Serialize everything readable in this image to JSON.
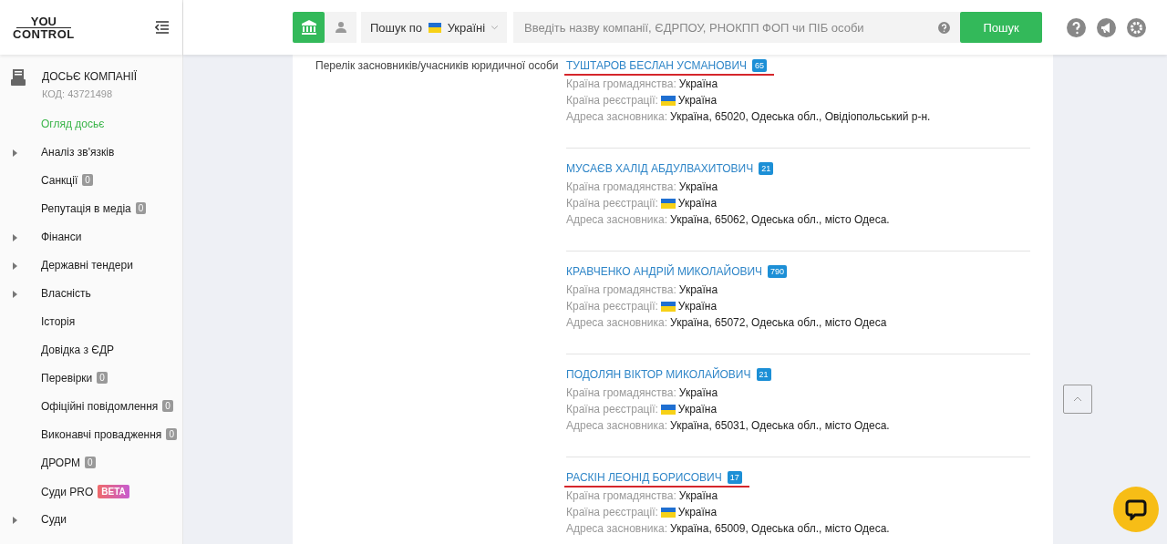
{
  "logo": {
    "top": "YOU",
    "bottom": "CONTROL"
  },
  "header": {
    "search_mode": "Пошук по",
    "country": "Україні",
    "search_placeholder": "Введіть назву компанії, ЄДРПОУ, РНОКПП ФОП чи ПІБ особи",
    "search_button": "Пошук"
  },
  "sidebar": {
    "title": "ДОСЬЄ КОМПАНІЇ",
    "code": "КОД: 43721498",
    "items": [
      {
        "label": "Огляд досьє",
        "selected": true,
        "expandable": false
      },
      {
        "label": "Аналіз зв'язків",
        "selected": false,
        "expandable": true
      },
      {
        "label": "Санкції",
        "selected": false,
        "expandable": false,
        "badge": "0",
        "kind": "count"
      },
      {
        "label": "Репутація в медіа",
        "selected": false,
        "expandable": false,
        "badge": "0",
        "kind": "count"
      },
      {
        "label": "Фінанси",
        "selected": false,
        "expandable": true
      },
      {
        "label": "Державні тендери",
        "selected": false,
        "expandable": true
      },
      {
        "label": "Власність",
        "selected": false,
        "expandable": true
      },
      {
        "label": "Історія",
        "selected": false,
        "expandable": false
      },
      {
        "label": "Довідка з ЄДР",
        "selected": false,
        "expandable": false
      },
      {
        "label": "Перевірки",
        "selected": false,
        "expandable": false,
        "badge": "0",
        "kind": "count"
      },
      {
        "label": "Офіційні повідомлення",
        "selected": false,
        "expandable": false,
        "badge": "0",
        "kind": "count"
      },
      {
        "label": "Виконавчі провадження",
        "selected": false,
        "expandable": false,
        "badge": "0",
        "kind": "count"
      },
      {
        "label": "ДРОРМ",
        "selected": false,
        "expandable": false,
        "badge": "0",
        "kind": "count"
      },
      {
        "label": "Суди PRO",
        "selected": false,
        "expandable": false,
        "badge": "BETA",
        "kind": "beta"
      },
      {
        "label": "Суди",
        "selected": false,
        "expandable": true
      }
    ]
  },
  "section": {
    "label": "Перелік засновників/учасників юридичної особи",
    "founders": [
      {
        "name": "ТУШТАРОВ БЕСЛАН УСМАНОВИЧ",
        "count": "65",
        "underlined": true,
        "citizenship_label": "Країна громадянства:",
        "citizenship": "Україна",
        "registration_label": "Країна реєстрації:",
        "registration": "Україна",
        "address_label": "Адреса засновника:",
        "address": "Україна, 65020, Одеська обл., Овідіопольський р-н."
      },
      {
        "name": "МУСАЄВ ХАЛІД АБДУЛВАХИТОВИЧ",
        "count": "21",
        "underlined": false,
        "citizenship_label": "Країна громадянства:",
        "citizenship": "Україна",
        "registration_label": "Країна реєстрації:",
        "registration": "Україна",
        "address_label": "Адреса засновника:",
        "address": "Україна, 65062, Одеська обл., місто Одеса."
      },
      {
        "name": "КРАВЧЕНКО АНДРІЙ МИКОЛАЙОВИЧ",
        "count": "790",
        "underlined": false,
        "citizenship_label": "Країна громадянства:",
        "citizenship": "Україна",
        "registration_label": "Країна реєстрації:",
        "registration": "Україна",
        "address_label": "Адреса засновника:",
        "address": "Україна, 65072, Одеська обл., місто Одеса"
      },
      {
        "name": "ПОДОЛЯН ВІКТОР МИКОЛАЙОВИЧ",
        "count": "21",
        "underlined": false,
        "citizenship_label": "Країна громадянства:",
        "citizenship": "Україна",
        "registration_label": "Країна реєстрації:",
        "registration": "Україна",
        "address_label": "Адреса засновника:",
        "address": "Україна, 65031, Одеська обл., місто Одеса."
      },
      {
        "name": "РАСКІН ЛЕОНІД БОРИСОВИЧ",
        "count": "17",
        "underlined": true,
        "citizenship_label": "Країна громадянства:",
        "citizenship": "Україна",
        "registration_label": "Країна реєстрації:",
        "registration": "Україна",
        "address_label": "Адреса засновника:",
        "address": "Україна, 65009, Одеська обл., місто Одеса."
      }
    ]
  }
}
